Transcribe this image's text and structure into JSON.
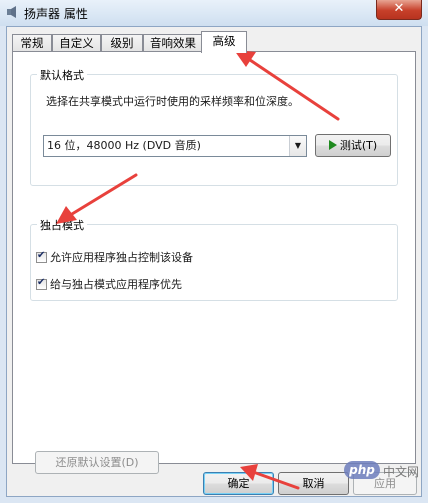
{
  "window": {
    "title": "扬声器 属性",
    "close_label": "✕"
  },
  "tabs": [
    {
      "label": "常规"
    },
    {
      "label": "自定义"
    },
    {
      "label": "级别"
    },
    {
      "label": "音响效果"
    },
    {
      "label": "高级"
    }
  ],
  "active_tab": "高级",
  "default_format": {
    "group_title": "默认格式",
    "description": "选择在共享模式中运行时使用的采样频率和位深度。",
    "selected_format": "16 位，48000 Hz (DVD 音质)",
    "test_button": "测试(T)"
  },
  "exclusive_mode": {
    "group_title": "独占模式",
    "options": [
      {
        "label": "允许应用程序独占控制该设备",
        "checked": true
      },
      {
        "label": "给与独占模式应用程序优先",
        "checked": true
      }
    ]
  },
  "restore_defaults_button": "还原默认设置(D)",
  "footer": {
    "ok": "确定",
    "cancel": "取消",
    "apply": "应用"
  },
  "watermark": {
    "logo": "php",
    "text": "中文网"
  },
  "colors": {
    "annotation_arrow": "#e8413c",
    "selected_tab_bg": "#ffffff"
  }
}
